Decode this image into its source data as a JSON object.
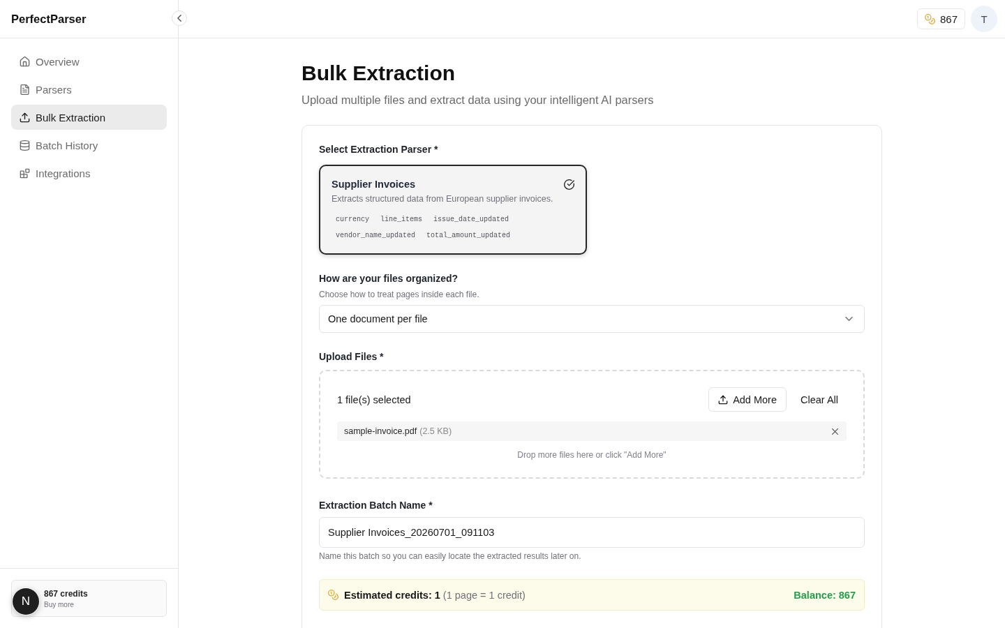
{
  "sidebar": {
    "logo": "PerfectParser",
    "items": [
      {
        "label": "Overview",
        "selected": false
      },
      {
        "label": "Parsers",
        "selected": false
      },
      {
        "label": "Bulk Extraction",
        "selected": true
      },
      {
        "label": "Batch History",
        "selected": false
      },
      {
        "label": "Integrations",
        "selected": false
      }
    ],
    "credits": {
      "count": "867 credits",
      "link": "Buy more"
    }
  },
  "header": {
    "credits": "867",
    "avatar": "T"
  },
  "dev_badge": "N",
  "page": {
    "title": "Bulk Extraction",
    "subtitle": "Upload multiple files and extract data using your intelligent AI parsers"
  },
  "form": {
    "parser_select": {
      "label": "Select Extraction Parser *",
      "parsers": [
        {
          "name": "Supplier Invoices",
          "description": "Extracts structured data from European supplier invoices.",
          "fields": [
            "currency",
            "line_items",
            "issue_date_updated",
            "vendor_name_updated",
            "total_amount_updated"
          ],
          "selected": true
        }
      ]
    },
    "organization": {
      "label": "How are your files organized?",
      "hint": "Choose how to treat pages inside each file.",
      "value": "One document per file"
    },
    "upload": {
      "label": "Upload Files *",
      "count": "1 file(s) selected",
      "add_button": "Add More",
      "clear_button": "Clear All",
      "files": [
        {
          "name": "sample-invoice.pdf",
          "size": "(2.5 KB)"
        }
      ],
      "drop_hint": "Drop more files here or click \"Add More\""
    },
    "batch_name": {
      "label": "Extraction Batch Name *",
      "value": "Supplier Invoices_20260701_091103",
      "help": "Name this batch so you can easily locate the extracted results later on."
    },
    "estimate": {
      "text": "**Estimated credits: 1** (1 page = 1 credit)",
      "balance": "Balance: 867"
    }
  }
}
